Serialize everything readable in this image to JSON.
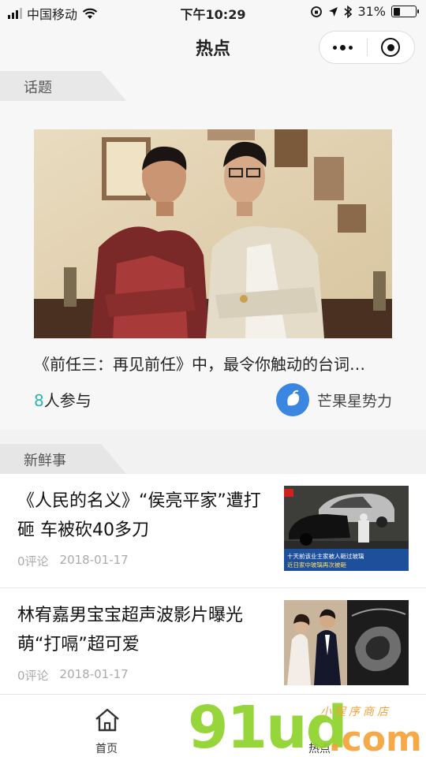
{
  "status_bar": {
    "carrier": "中国移动",
    "time": "下午10:29",
    "battery": "31%",
    "battery_level": 0.31
  },
  "nav": {
    "title": "热点"
  },
  "topic_section": {
    "header": "话题",
    "card": {
      "title": "《前任三：再见前任》中，最令你触动的台词…",
      "participants_count": "8",
      "participants_suffix": "人参与",
      "source_name": "芒果星势力"
    }
  },
  "news_section": {
    "header": "新鲜事",
    "items": [
      {
        "title": "《人民的名义》“侯亮平家”遭打砸 车被砍40多刀",
        "comments": "0评论",
        "date": "2018-01-17",
        "thumb_caption_1": "十天前该业主家被人砸过玻璃",
        "thumb_caption_2": "近日家中玻璃再次被砸"
      },
      {
        "title": "林宥嘉男宝宝超声波影片曝光 萌“打嗝”超可爱",
        "comments": "0评论",
        "date": "2018-01-17"
      }
    ]
  },
  "tab_bar": {
    "tabs": [
      {
        "label": "首页",
        "icon": "home-icon"
      },
      {
        "label": "热点",
        "icon": "flame-icon"
      }
    ]
  },
  "watermark": {
    "brand": "91ud",
    "domain": ".com",
    "tagline": "小程序商店"
  }
}
